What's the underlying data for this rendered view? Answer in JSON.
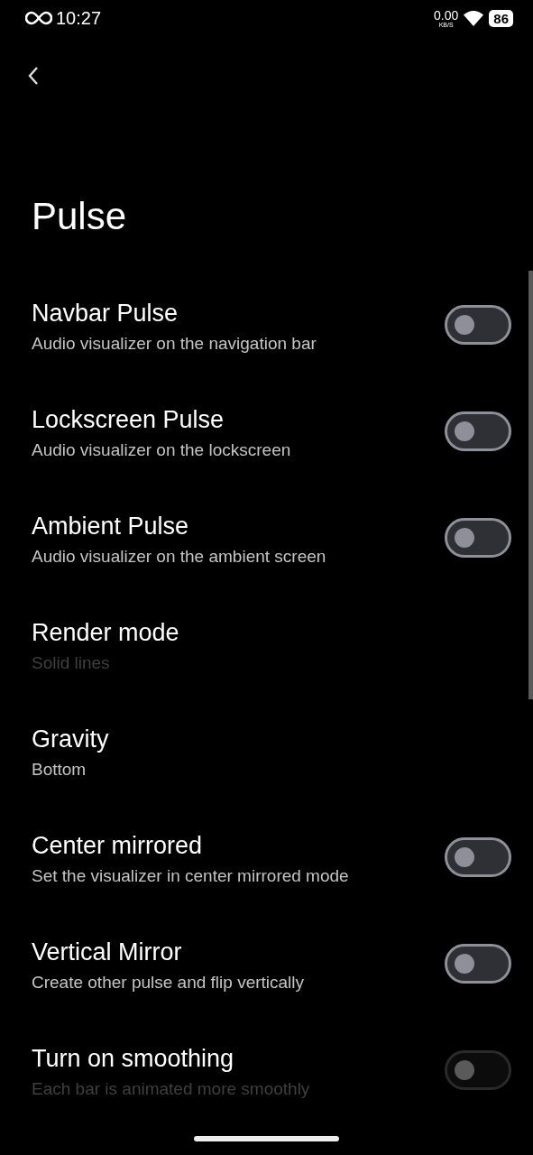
{
  "status_bar": {
    "time": "10:27",
    "speed": "0.00",
    "speed_unit": "KB/S",
    "battery": "86"
  },
  "title": "Pulse",
  "items": [
    {
      "kind": "switch",
      "title": "Navbar Pulse",
      "summary": "Audio visualizer on the navigation bar",
      "on": false,
      "disabled": false
    },
    {
      "kind": "switch",
      "title": "Lockscreen Pulse",
      "summary": "Audio visualizer on the lockscreen",
      "on": false,
      "disabled": false
    },
    {
      "kind": "switch",
      "title": "Ambient Pulse",
      "summary": "Audio visualizer on the ambient screen",
      "on": false,
      "disabled": false
    },
    {
      "kind": "option",
      "title": "Render mode",
      "summary": "Solid lines",
      "disabled": true
    },
    {
      "kind": "option",
      "title": "Gravity",
      "summary": "Bottom",
      "disabled": false
    },
    {
      "kind": "switch",
      "title": "Center mirrored",
      "summary": "Set the visualizer in center mirrored mode",
      "on": false,
      "disabled": false
    },
    {
      "kind": "switch",
      "title": "Vertical Mirror",
      "summary": "Create other pulse and flip vertically",
      "on": false,
      "disabled": false
    },
    {
      "kind": "switch",
      "title": "Turn on smoothing",
      "summary": "Each bar is animated more smoothly",
      "on": false,
      "disabled": true
    }
  ]
}
